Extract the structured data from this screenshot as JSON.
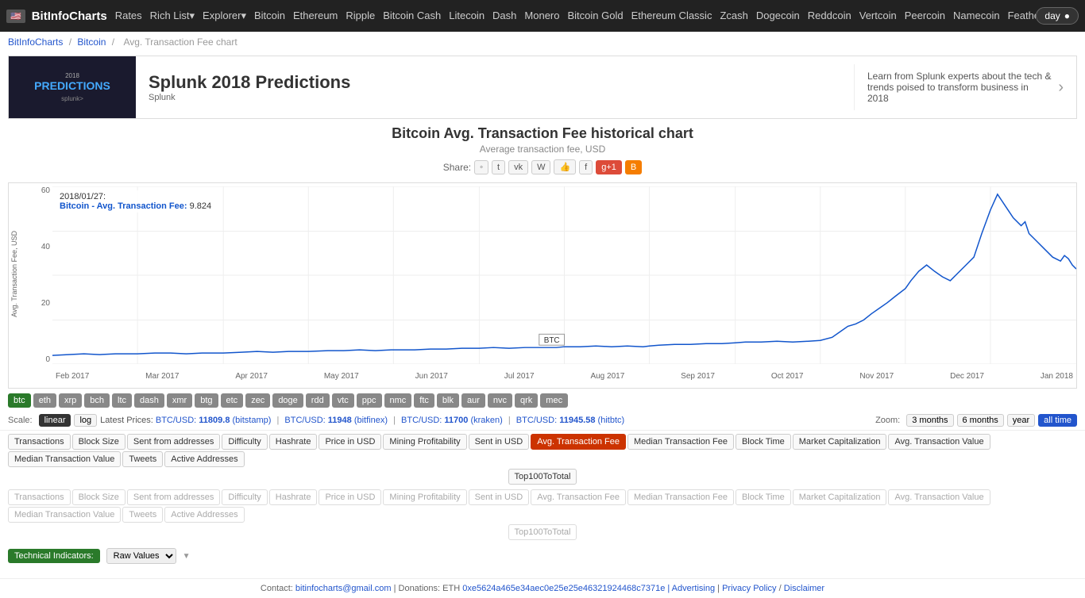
{
  "topnav": {
    "logo": "BitInfoCharts",
    "flag": "🇺🇸",
    "links": [
      "Rates",
      "Rich List▾",
      "Explorer▾",
      "Bitcoin",
      "Ethereum",
      "Ripple",
      "Bitcoin Cash",
      "Litecoin",
      "Dash",
      "Monero",
      "Bitcoin Gold",
      "Ethereum Classic",
      "Zcash",
      "Dogecoin",
      "Reddcoin",
      "Vertcoin",
      "Peercoin",
      "Namecoin",
      "Feathercoin"
    ],
    "day_toggle": "day"
  },
  "breadcrumb": {
    "home": "BitInfoCharts",
    "sep1": "/",
    "coin": "Bitcoin",
    "sep2": "/",
    "current": "Avg. Transaction Fee chart"
  },
  "ad": {
    "img_text": "2018 PREDICTIONS",
    "title": "Splunk 2018 Predictions",
    "sub": "Splunk",
    "right": "Learn from Splunk experts about the tech & trends poised to transform business in 2018"
  },
  "chart": {
    "title": "Bitcoin Avg. Transaction Fee historical chart",
    "subtitle": "Average transaction fee, USD",
    "share_label": "Share:",
    "share_btns": [
      "reddit",
      "twitter",
      "vk",
      "wiki",
      "like",
      "facebook",
      "g+1",
      "blogger"
    ],
    "yaxis_title": "Avg. Transaction Fee, USD",
    "yaxis_labels": [
      "60",
      "40",
      "20",
      "0"
    ],
    "xaxis_labels": [
      "Feb 2017",
      "Mar 2017",
      "Apr 2017",
      "May 2017",
      "Jun 2017",
      "Jul 2017",
      "Aug 2017",
      "Sep 2017",
      "Oct 2017",
      "Nov 2017",
      "Dec 2017",
      "Jan 2018"
    ],
    "tooltip_date": "2018/01/27:",
    "tooltip_label": "Bitcoin - Avg. Transaction Fee:",
    "tooltip_value": "9.824",
    "btc_label": "BTC"
  },
  "coins": [
    {
      "id": "btc",
      "label": "btc",
      "active": true
    },
    {
      "id": "eth",
      "label": "eth",
      "active": false
    },
    {
      "id": "xrp",
      "label": "xrp",
      "active": false
    },
    {
      "id": "bch",
      "label": "bch",
      "active": false
    },
    {
      "id": "ltc",
      "label": "ltc",
      "active": false
    },
    {
      "id": "dash",
      "label": "dash",
      "active": false
    },
    {
      "id": "xmr",
      "label": "xmr",
      "active": false
    },
    {
      "id": "btg",
      "label": "btg",
      "active": false
    },
    {
      "id": "etc",
      "label": "etc",
      "active": false
    },
    {
      "id": "zec",
      "label": "zec",
      "active": false
    },
    {
      "id": "doge",
      "label": "doge",
      "active": false
    },
    {
      "id": "rdd",
      "label": "rdd",
      "active": false
    },
    {
      "id": "vtc",
      "label": "vtc",
      "active": false
    },
    {
      "id": "ppc",
      "label": "ppc",
      "active": false
    },
    {
      "id": "nmc",
      "label": "nmc",
      "active": false
    },
    {
      "id": "ftc",
      "label": "ftc",
      "active": false
    },
    {
      "id": "blk",
      "label": "blk",
      "active": false
    },
    {
      "id": "aur",
      "label": "aur",
      "active": false
    },
    {
      "id": "nvc",
      "label": "nvc",
      "active": false
    },
    {
      "id": "qrk",
      "label": "qrk",
      "active": false
    },
    {
      "id": "mec",
      "label": "mec",
      "active": false
    }
  ],
  "scale": {
    "label": "Scale:",
    "options": [
      {
        "id": "linear",
        "label": "linear",
        "active": true
      },
      {
        "id": "log",
        "label": "log",
        "active": false
      }
    ],
    "prices_text": "Latest Prices:",
    "prices": [
      {
        "pair": "BTC/USD:",
        "value": "11809.8",
        "source": "bitstamp"
      },
      {
        "pair": "BTC/USD:",
        "value": "11948",
        "source": "bitfinex"
      },
      {
        "pair": "BTC/USD:",
        "value": "11700",
        "source": "kraken"
      },
      {
        "pair": "BTC/USD:",
        "value": "11945.58",
        "source": "hitbtc"
      }
    ]
  },
  "zoom": {
    "label": "Zoom:",
    "options": [
      {
        "id": "3months",
        "label": "3 months",
        "active": false
      },
      {
        "id": "6months",
        "label": "6 months",
        "active": false
      },
      {
        "id": "year",
        "label": "year",
        "active": false
      },
      {
        "id": "all",
        "label": "all time",
        "active": true
      }
    ]
  },
  "metrics": {
    "label": "metric tabs",
    "tabs": [
      "Transactions",
      "Block Size",
      "Sent from addresses",
      "Difficulty",
      "Hashrate",
      "Price in USD",
      "Mining Profitability",
      "Sent in USD",
      "Avg. Transaction Fee",
      "Median Transaction Fee",
      "Block Time",
      "Market Capitalization",
      "Avg. Transaction Value",
      "Median Transaction Value",
      "Tweets",
      "Active Addresses"
    ],
    "active": "Avg. Transaction Fee",
    "center_tab": "Top100ToTotal"
  },
  "metrics2": {
    "tabs": [
      "Transactions",
      "Block Size",
      "Sent from addresses",
      "Difficulty",
      "Hashrate",
      "Price in USD",
      "Mining Profitability",
      "Sent in USD",
      "Avg. Transaction Fee",
      "Median Transaction Fee",
      "Block Time",
      "Market Capitalization",
      "Avg. Transaction Value",
      "Median Transaction Value",
      "Tweets",
      "Active Addresses"
    ],
    "center_tab": "Top100ToTotal"
  },
  "tech": {
    "label": "Technical Indicators:",
    "select_value": "Raw Values"
  },
  "footer": {
    "contact_label": "Contact:",
    "email": "bitinfocharts@gmail.com",
    "donations_label": "| Donations: ETH",
    "eth_address": "0xe5624a465e34aec0e25e25e46321924468c7371e",
    "advertising": "| Advertising",
    "privacy": "Privacy Policy",
    "disclaimer": "Disclaimer"
  }
}
